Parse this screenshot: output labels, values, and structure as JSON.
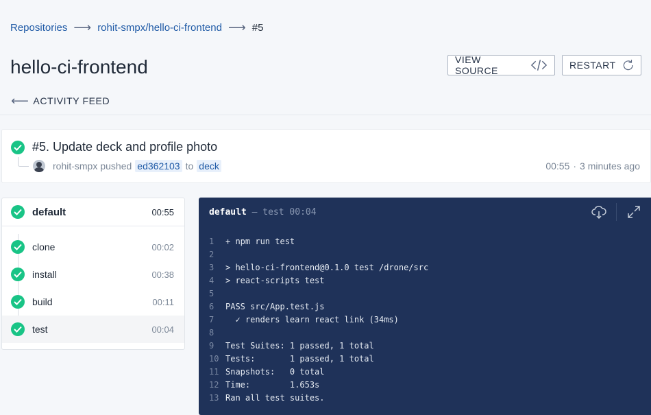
{
  "breadcrumb": {
    "items": [
      "Repositories",
      "rohit-smpx/hello-ci-frontend"
    ],
    "current": "#5"
  },
  "page_title": "hello-ci-frontend",
  "buttons": {
    "view_source": "VIEW SOURCE",
    "restart": "RESTART"
  },
  "activity_link": "ACTIVITY FEED",
  "build": {
    "title": "#5. Update deck and profile photo",
    "author": "rohit-smpx",
    "action": "pushed",
    "commit": "ed362103",
    "to": "to",
    "branch": "deck",
    "duration": "00:55",
    "time_ago": "3 minutes ago"
  },
  "stage": {
    "name": "default",
    "duration": "00:55"
  },
  "steps": [
    {
      "name": "clone",
      "duration": "00:02"
    },
    {
      "name": "install",
      "duration": "00:38"
    },
    {
      "name": "build",
      "duration": "00:11"
    },
    {
      "name": "test",
      "duration": "00:04"
    }
  ],
  "log": {
    "stage": "default",
    "dash": "—",
    "step": "test",
    "duration": "00:04",
    "lines": [
      {
        "n": "1",
        "text": "+ npm run test"
      },
      {
        "n": "2",
        "text": ""
      },
      {
        "n": "3",
        "text": "> hello-ci-frontend@0.1.0 test /drone/src"
      },
      {
        "n": "4",
        "text": "> react-scripts test"
      },
      {
        "n": "5",
        "text": ""
      },
      {
        "n": "6",
        "text": "PASS src/App.test.js"
      },
      {
        "n": "7",
        "text": "  ✓ renders learn react link (34ms)"
      },
      {
        "n": "8",
        "text": ""
      },
      {
        "n": "9",
        "text": "Test Suites: 1 passed, 1 total"
      },
      {
        "n": "10",
        "text": "Tests:       1 passed, 1 total"
      },
      {
        "n": "11",
        "text": "Snapshots:   0 total"
      },
      {
        "n": "12",
        "text": "Time:        1.653s"
      },
      {
        "n": "13",
        "text": "Ran all test suites."
      }
    ]
  },
  "colors": {
    "success": "#19c486",
    "link": "#1f5aa6",
    "log_bg": "#1f3259"
  },
  "icons": [
    "arrow-right-icon",
    "code-icon",
    "refresh-icon",
    "arrow-left-icon",
    "check-icon",
    "download-cloud-icon",
    "expand-icon"
  ]
}
